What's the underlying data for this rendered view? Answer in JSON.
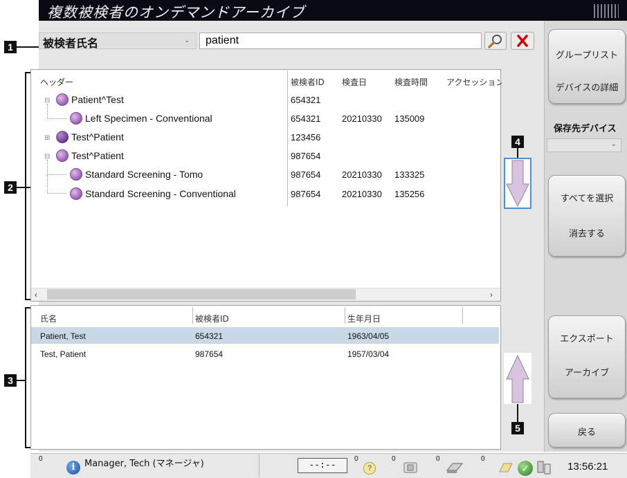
{
  "title": "複数被検者のオンデマンドアーカイブ",
  "search": {
    "field_selected": "被検者氏名",
    "query": "patient"
  },
  "callouts": [
    "1",
    "2",
    "3",
    "4",
    "5"
  ],
  "tree": {
    "headers": [
      "ヘッダー",
      "被検者ID",
      "検査日",
      "検査時間",
      "アクセッション番"
    ],
    "rows": [
      {
        "label": "Patient^Test",
        "id": "654321",
        "date": "",
        "time": "",
        "icon": "check-circle-icon",
        "level": 0
      },
      {
        "label": "Left Specimen - Conventional",
        "id": "654321",
        "date": "20210330",
        "time": "135009",
        "icon": "check-circle-icon",
        "level": 1
      },
      {
        "label": "Test^Patient",
        "id": "123456",
        "date": "",
        "time": "",
        "icon": "purple-ball-icon",
        "level": 0
      },
      {
        "label": "Test^Patient",
        "id": "987654",
        "date": "",
        "time": "",
        "icon": "check-circle-icon",
        "level": 0
      },
      {
        "label": "Standard Screening - Tomo",
        "id": "987654",
        "date": "20210330",
        "time": "133325",
        "icon": "check-circle-icon",
        "level": 1
      },
      {
        "label": "Standard Screening - Conventional",
        "id": "987654",
        "date": "20210330",
        "time": "135256",
        "icon": "check-circle-icon",
        "level": 1
      }
    ]
  },
  "patients": {
    "headers": [
      "氏名",
      "被検者ID",
      "生年月日"
    ],
    "rows": [
      {
        "name": "Patient, Test",
        "id": "654321",
        "dob": "1963/04/05",
        "selected": true
      },
      {
        "name": "Test, Patient",
        "id": "987654",
        "dob": "1957/03/04",
        "selected": false
      }
    ]
  },
  "side": {
    "group_list": "グループリスト",
    "device_details": "デバイスの詳細",
    "destination_label": "保存先デバイス",
    "destination_value": "",
    "select_all": "すべてを選択",
    "clear": "消去する",
    "export": "エクスポート",
    "archive": "アーカイブ",
    "back": "戻る"
  },
  "status": {
    "count_left": "0",
    "user": "Manager, Tech (マネージャ)",
    "clock_display": "--:--",
    "count_1": "0",
    "count_2": "0",
    "count_3": "0",
    "count_4": "0",
    "time": "13:56:21"
  },
  "colors": {
    "title_bg": "#0a0a14",
    "selected_row": "#c8d8e6",
    "arrow_highlight": "#4a90d9",
    "arrow_fill": "#d9c3e0",
    "clear_red": "#d40000"
  }
}
